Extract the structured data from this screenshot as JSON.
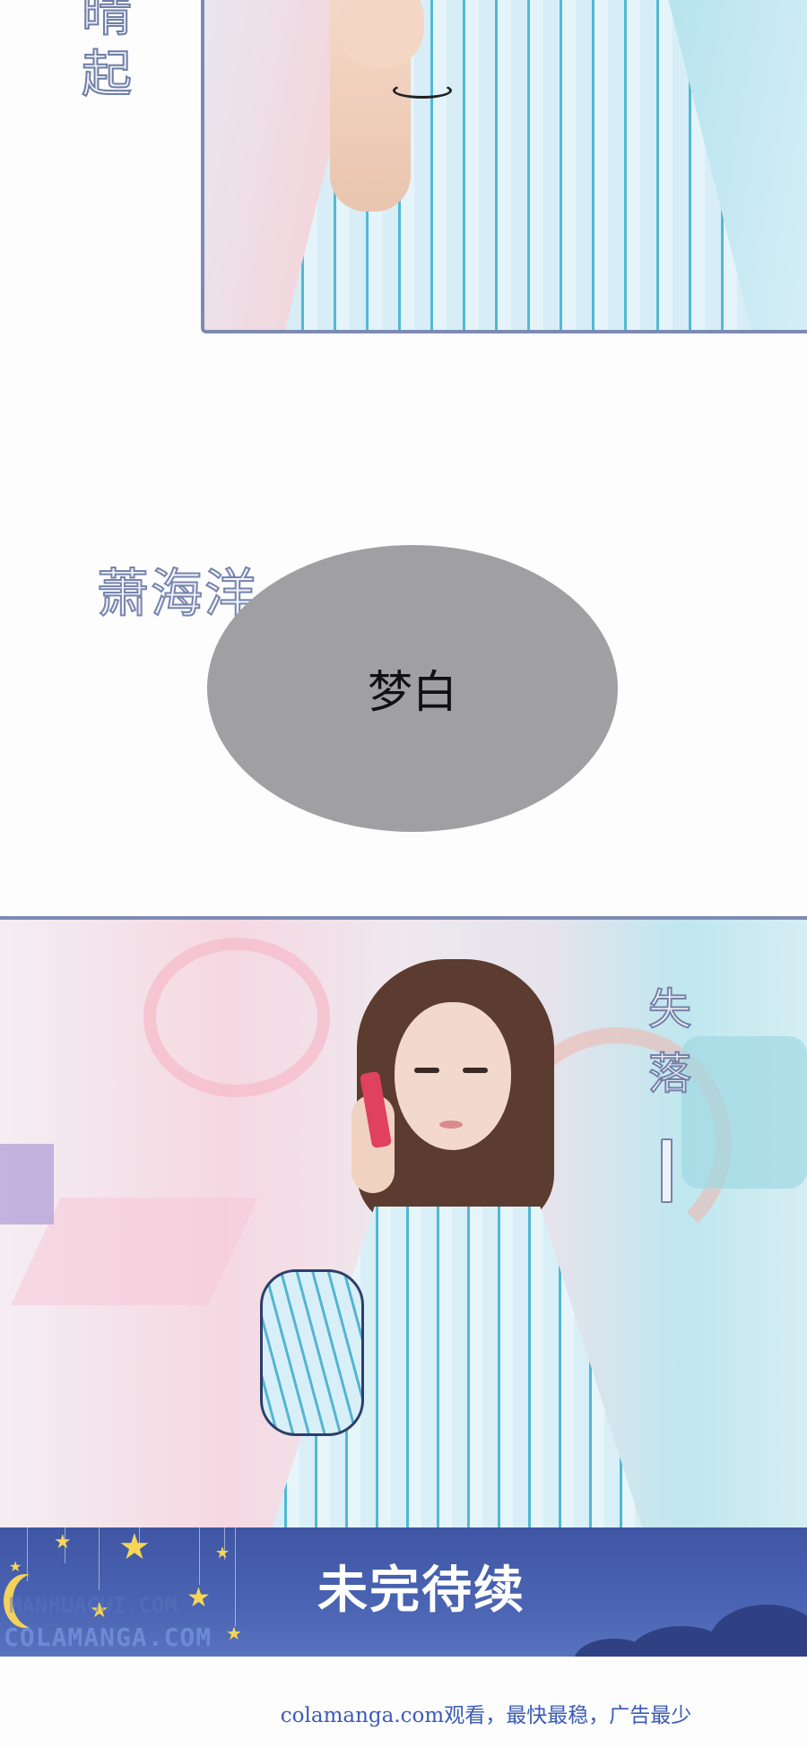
{
  "top_panel": {
    "vertical_text": [
      "晴",
      "起"
    ]
  },
  "middle": {
    "character_name": "萧海洋",
    "speech_bubble_text": "梦白"
  },
  "bottom_panel": {
    "vertical_text": [
      "失",
      "落"
    ]
  },
  "banner": {
    "title": "未完待续",
    "watermark": "COLAMANGA.COM",
    "watermark_ghost": "MANHUAGUI.COM"
  },
  "footer": {
    "text": "colamanga.com观看，最快最稳，广告最少"
  },
  "colors": {
    "frame_border": "#7d8bb3",
    "banner_bg": "#4a64b3",
    "bubble_bg": "#a0a0a2",
    "footer_text": "#3c5bb7"
  }
}
